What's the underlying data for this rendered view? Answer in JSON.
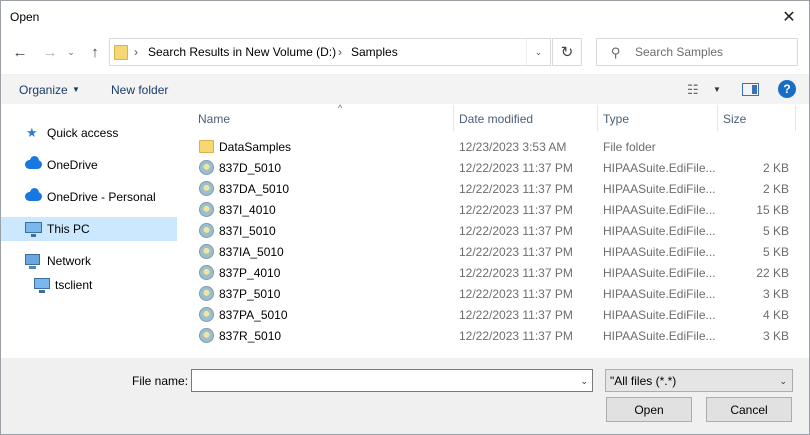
{
  "window": {
    "title": "Open",
    "close_glyph": "✕"
  },
  "nav": {
    "back_glyph": "←",
    "forward_glyph": "→",
    "recent_glyph": "⌄",
    "up_glyph": "↑",
    "address": {
      "separator": "›",
      "segments": [
        "Search Results in New Volume (D:)",
        "Samples"
      ],
      "dropdown_glyph": "⌄"
    },
    "refresh_glyph": "↻",
    "search_placeholder": "Search Samples",
    "search_glyph": "⚲"
  },
  "toolbar": {
    "organize_label": "Organize",
    "caret": "▼",
    "new_folder_label": "New folder",
    "view_glyph": "☷",
    "help_glyph": "?"
  },
  "sidebar": {
    "items": [
      {
        "label": "Quick access",
        "icon": "star-icon"
      },
      {
        "label": "OneDrive",
        "icon": "cloud-icon"
      },
      {
        "label": "OneDrive - Personal",
        "icon": "cloud-icon"
      },
      {
        "label": "This PC",
        "icon": "computer-icon",
        "selected": true
      },
      {
        "label": "Network",
        "icon": "network-icon"
      },
      {
        "label": "tsclient",
        "icon": "computer-icon"
      }
    ],
    "star_glyph": "★"
  },
  "columns": {
    "name": "Name",
    "date": "Date modified",
    "type": "Type",
    "size": "Size",
    "sort_glyph": "^"
  },
  "files": [
    {
      "name": "DataSamples",
      "date": "12/23/2023 3:53 AM",
      "type": "File folder",
      "size": "",
      "icon": "folder-icon"
    },
    {
      "name": "837D_5010",
      "date": "12/22/2023 11:37 PM",
      "type": "HIPAASuite.EdiFile...",
      "size": "2 KB",
      "icon": "edi-file-icon"
    },
    {
      "name": "837DA_5010",
      "date": "12/22/2023 11:37 PM",
      "type": "HIPAASuite.EdiFile...",
      "size": "2 KB",
      "icon": "edi-file-icon"
    },
    {
      "name": "837I_4010",
      "date": "12/22/2023 11:37 PM",
      "type": "HIPAASuite.EdiFile...",
      "size": "15 KB",
      "icon": "edi-file-icon"
    },
    {
      "name": "837I_5010",
      "date": "12/22/2023 11:37 PM",
      "type": "HIPAASuite.EdiFile...",
      "size": "5 KB",
      "icon": "edi-file-icon"
    },
    {
      "name": "837IA_5010",
      "date": "12/22/2023 11:37 PM",
      "type": "HIPAASuite.EdiFile...",
      "size": "5 KB",
      "icon": "edi-file-icon"
    },
    {
      "name": "837P_4010",
      "date": "12/22/2023 11:37 PM",
      "type": "HIPAASuite.EdiFile...",
      "size": "22 KB",
      "icon": "edi-file-icon"
    },
    {
      "name": "837P_5010",
      "date": "12/22/2023 11:37 PM",
      "type": "HIPAASuite.EdiFile...",
      "size": "3 KB",
      "icon": "edi-file-icon"
    },
    {
      "name": "837PA_5010",
      "date": "12/22/2023 11:37 PM",
      "type": "HIPAASuite.EdiFile...",
      "size": "4 KB",
      "icon": "edi-file-icon"
    },
    {
      "name": "837R_5010",
      "date": "12/22/2023 11:37 PM",
      "type": "HIPAASuite.EdiFile...",
      "size": "3 KB",
      "icon": "edi-file-icon"
    }
  ],
  "bottom": {
    "file_name_label": "File name:",
    "file_name_value": "",
    "combo_glyph": "⌄",
    "filter_value": "\"All files (*.*)",
    "open_label": "Open",
    "cancel_label": "Cancel"
  }
}
